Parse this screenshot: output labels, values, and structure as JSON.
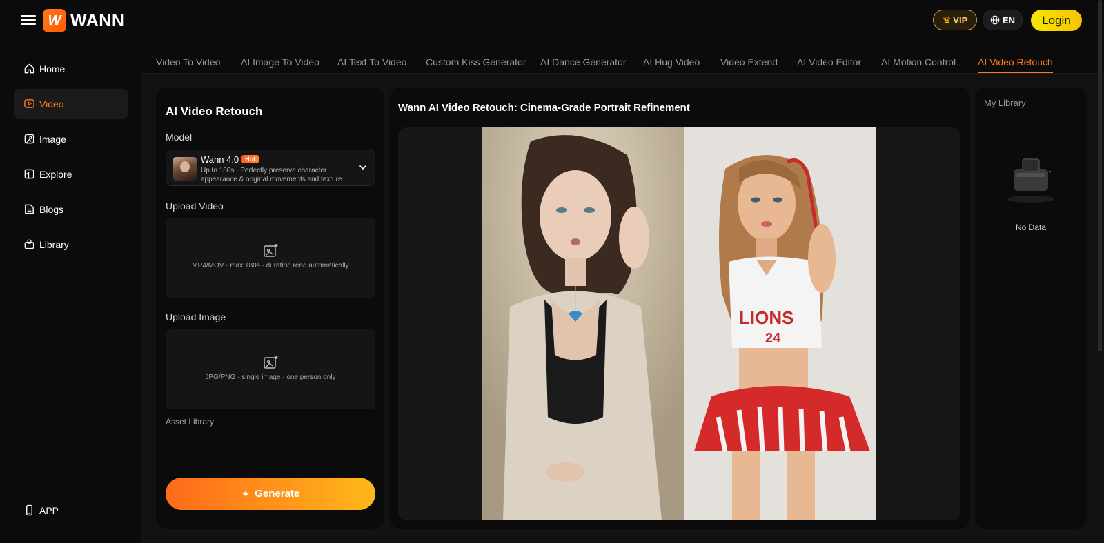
{
  "header": {
    "brand": "WANN",
    "logo_letter": "W",
    "vip_label": "VIP",
    "lang_label": "EN",
    "login_label": "Login"
  },
  "sidebar": {
    "items": [
      {
        "label": "Home",
        "icon": "home-icon"
      },
      {
        "label": "Video",
        "icon": "video-icon",
        "active": true
      },
      {
        "label": "Image",
        "icon": "image-icon"
      },
      {
        "label": "Explore",
        "icon": "explore-icon"
      },
      {
        "label": "Blogs",
        "icon": "blogs-icon"
      },
      {
        "label": "Library",
        "icon": "library-icon"
      }
    ],
    "app_label": "APP"
  },
  "tabs": [
    {
      "label": "Video To Video"
    },
    {
      "label": "AI Image To Video"
    },
    {
      "label": "AI Text To Video"
    },
    {
      "label": "Custom Kiss Generator"
    },
    {
      "label": "AI Dance Generator"
    },
    {
      "label": "AI Hug Video"
    },
    {
      "label": "Video Extend"
    },
    {
      "label": "AI Video Editor"
    },
    {
      "label": "AI Motion Control"
    },
    {
      "label": "AI Video Retouch",
      "active": true
    }
  ],
  "form": {
    "title": "AI Video Retouch",
    "model_label": "Model",
    "model_name": "Wann 4.0",
    "model_badge": "Hot",
    "model_desc": "Up to 180s · Perfectly preserve character appearance & original movements and texture",
    "upload_video_label": "Upload Video",
    "upload_video_hint": "MP4/MOV · max 180s · duration read automatically",
    "upload_image_label": "Upload Image",
    "upload_image_hint": "JPG/PNG · single image · one person only",
    "asset_library_label": "Asset Library",
    "generate_label": "Generate"
  },
  "preview": {
    "title": "Wann AI Video Retouch: Cinema-Grade Portrait Refinement",
    "jersey_text_1": "LIONS",
    "jersey_text_2": "24"
  },
  "library": {
    "title": "My Library",
    "empty_text": "No Data"
  },
  "colors": {
    "accent": "#ff7a1a",
    "login": "#f6e600",
    "vip_border": "#d8a33a"
  }
}
